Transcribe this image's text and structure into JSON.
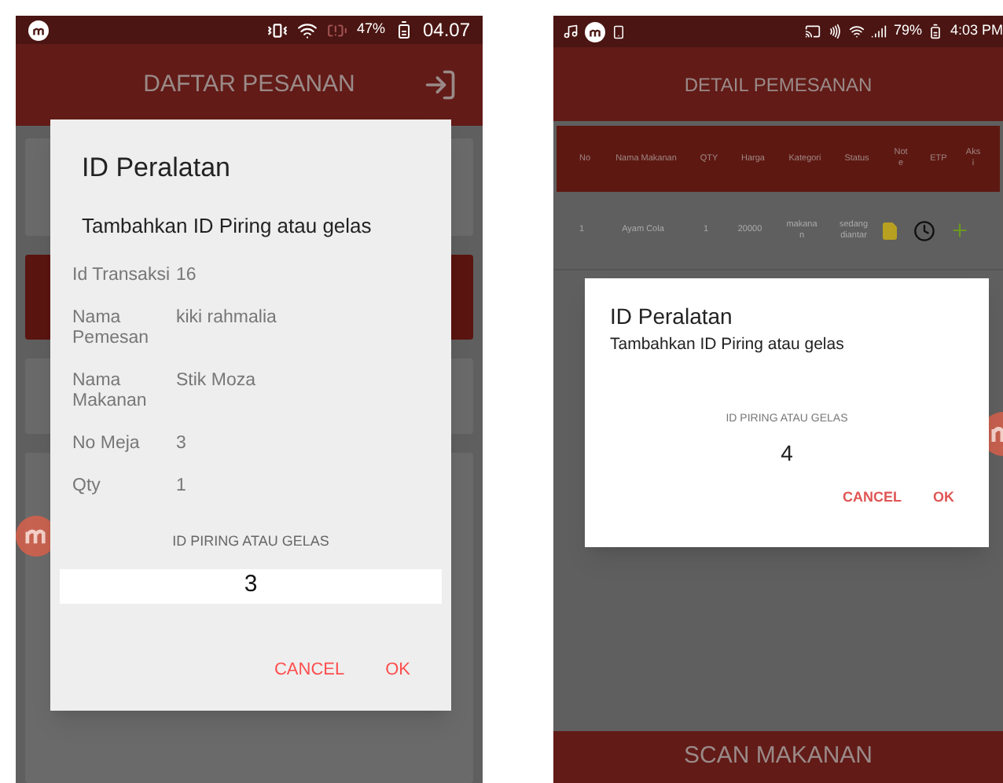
{
  "left_screen": {
    "status_bar": {
      "battery": "47%",
      "time": "04.07"
    },
    "title": "DAFTAR PESANAN",
    "dialog": {
      "title": "ID Peralatan",
      "subtitle": "Tambahkan ID Piring atau gelas",
      "details": [
        {
          "label": "Id Transaksi",
          "value": "16"
        },
        {
          "label": "Nama Pemesan",
          "value": "kiki rahmalia"
        },
        {
          "label": "Nama Makanan",
          "value": "Stik Moza"
        },
        {
          "label": "No Meja",
          "value": "3"
        },
        {
          "label": "Qty",
          "value": "1"
        }
      ],
      "field_label": "ID PIRING ATAU GELAS",
      "field_value": "3",
      "buttons": [
        "CANCEL",
        "OK"
      ]
    }
  },
  "right_screen": {
    "status_bar": {
      "battery": "79%",
      "time": "4:03 PM"
    },
    "title": "DETAIL PEMESANAN",
    "table": {
      "columns": [
        "No",
        "Nama Makanan",
        "QTY",
        "Harga",
        "Kategori",
        "Status",
        "Not\ne",
        "ETP",
        "Aks\ni"
      ],
      "rows": [
        [
          "1",
          "Ayam Cola",
          "1",
          "20000",
          "makana\nn",
          "sedang\ndiantar"
        ]
      ]
    },
    "dialog": {
      "title": "ID Peralatan",
      "subtitle": "Tambahkan ID Piring atau gelas",
      "field_label": "ID PIRING ATAU GELAS",
      "field_value": "4",
      "buttons": [
        "CANCEL",
        "OK"
      ]
    },
    "bottom_button": "SCAN MAKANAN"
  }
}
